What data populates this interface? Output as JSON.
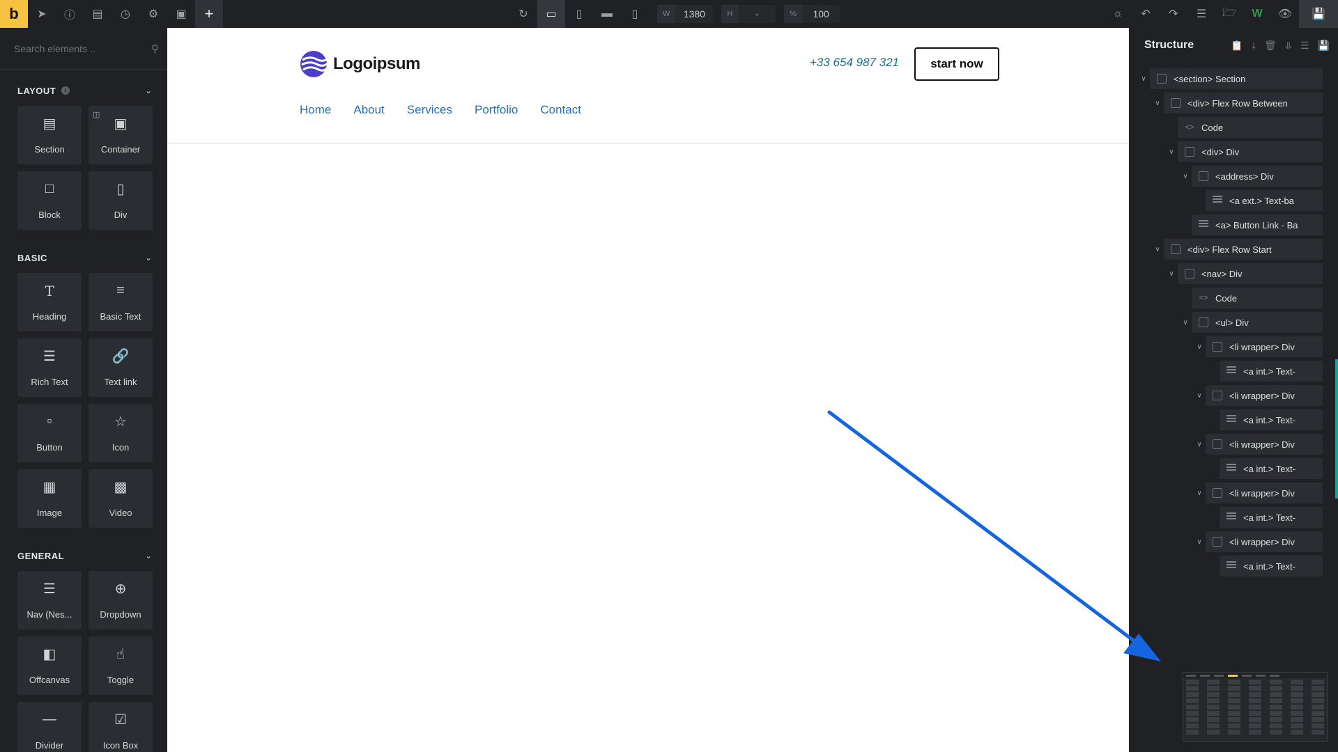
{
  "toolbar": {
    "brand": "b",
    "width_label": "W",
    "width_value": "1380",
    "height_label": "H",
    "height_value": "-",
    "zoom_label": "%",
    "zoom_value": "100",
    "add_label": "+"
  },
  "elements_panel": {
    "search_placeholder": "Search elements ..",
    "groups": [
      {
        "title": "LAYOUT",
        "items": [
          {
            "label": "Section",
            "icon": "section-icon"
          },
          {
            "label": "Container",
            "icon": "container-icon"
          },
          {
            "label": "Block",
            "icon": "block-icon"
          },
          {
            "label": "Div",
            "icon": "div-icon"
          }
        ]
      },
      {
        "title": "BASIC",
        "items": [
          {
            "label": "Heading",
            "icon": "heading-icon"
          },
          {
            "label": "Basic Text",
            "icon": "basic-text-icon"
          },
          {
            "label": "Rich Text",
            "icon": "rich-text-icon"
          },
          {
            "label": "Text link",
            "icon": "text-link-icon"
          },
          {
            "label": "Button",
            "icon": "button-icon"
          },
          {
            "label": "Icon",
            "icon": "star-icon"
          },
          {
            "label": "Image",
            "icon": "image-icon"
          },
          {
            "label": "Video",
            "icon": "video-icon"
          }
        ]
      },
      {
        "title": "GENERAL",
        "items": [
          {
            "label": "Nav (Nes...",
            "icon": "nav-icon"
          },
          {
            "label": "Dropdown",
            "icon": "dropdown-icon"
          },
          {
            "label": "Offcanvas",
            "icon": "offcanvas-icon"
          },
          {
            "label": "Toggle",
            "icon": "toggle-icon"
          },
          {
            "label": "Divider",
            "icon": "divider-icon"
          },
          {
            "label": "Icon Box",
            "icon": "icon-box-icon"
          }
        ]
      }
    ]
  },
  "site": {
    "logo_text": "Logoipsum",
    "phone": "+33 654 987 321",
    "cta": "start now",
    "nav": [
      "Home",
      "About",
      "Services",
      "Portfolio",
      "Contact"
    ]
  },
  "structure": {
    "title": "Structure",
    "nodes": [
      {
        "label": "<section> Section",
        "depth": 0,
        "icon": "box",
        "toggle": true
      },
      {
        "label": "<div> Flex Row Between",
        "depth": 1,
        "icon": "box",
        "toggle": true
      },
      {
        "label": "Code",
        "depth": 2,
        "icon": "code",
        "toggle": false
      },
      {
        "label": "<div> Div",
        "depth": 2,
        "icon": "box",
        "toggle": true
      },
      {
        "label": "<address> Div",
        "depth": 3,
        "icon": "box",
        "toggle": true
      },
      {
        "label": "<a ext.> Text-ba",
        "depth": 4,
        "icon": "lines",
        "toggle": false
      },
      {
        "label": "<a> Button Link - Ba",
        "depth": 3,
        "icon": "lines",
        "toggle": false
      },
      {
        "label": "<div> Flex Row Start",
        "depth": 1,
        "icon": "box",
        "toggle": true
      },
      {
        "label": "<nav> Div",
        "depth": 2,
        "icon": "box",
        "toggle": true
      },
      {
        "label": "Code",
        "depth": 3,
        "icon": "code",
        "toggle": false
      },
      {
        "label": "<ul> Div",
        "depth": 3,
        "icon": "box",
        "toggle": true
      },
      {
        "label": "<li wrapper> Div",
        "depth": 4,
        "icon": "box",
        "toggle": true
      },
      {
        "label": "<a int.> Text-",
        "depth": 5,
        "icon": "lines",
        "toggle": false
      },
      {
        "label": "<li wrapper> Div",
        "depth": 4,
        "icon": "box",
        "toggle": true
      },
      {
        "label": "<a int.> Text-",
        "depth": 5,
        "icon": "lines",
        "toggle": false
      },
      {
        "label": "<li wrapper> Div",
        "depth": 4,
        "icon": "box",
        "toggle": true
      },
      {
        "label": "<a int.> Text-",
        "depth": 5,
        "icon": "lines",
        "toggle": false
      },
      {
        "label": "<li wrapper> Div",
        "depth": 4,
        "icon": "box",
        "toggle": true
      },
      {
        "label": "<a int.> Text-",
        "depth": 5,
        "icon": "lines",
        "toggle": false
      },
      {
        "label": "<li wrapper> Div",
        "depth": 4,
        "icon": "box",
        "toggle": true
      },
      {
        "label": "<a int.> Text-",
        "depth": 5,
        "icon": "lines",
        "toggle": false
      }
    ]
  },
  "colors": {
    "accent": "#f5c242",
    "panel": "#1f2124",
    "arrow": "#1565e0",
    "nav_link": "#2a6fb0",
    "phone": "#1e6b8a"
  }
}
